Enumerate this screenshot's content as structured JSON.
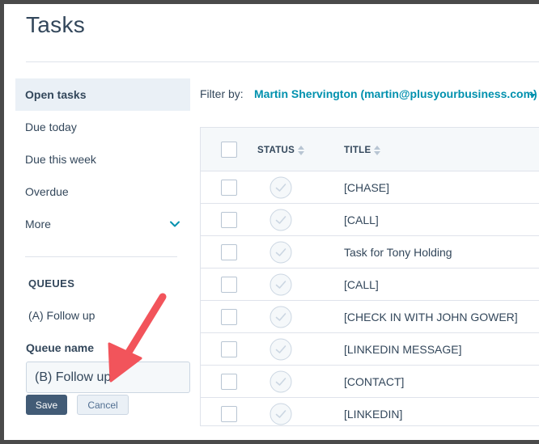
{
  "page": {
    "title": "Tasks"
  },
  "sidebar": {
    "items": [
      {
        "label": "Open tasks",
        "active": true
      },
      {
        "label": "Due today"
      },
      {
        "label": "Due this week"
      },
      {
        "label": "Overdue"
      },
      {
        "label": "More"
      }
    ],
    "queues_heading": "QUEUES",
    "queue_items": [
      "(A) Follow up"
    ],
    "queue_name_label": "Queue name",
    "queue_name_value": "(B) Follow up",
    "save_label": "Save",
    "cancel_label": "Cancel"
  },
  "filter": {
    "label": "Filter by:",
    "value": "Martin Shervington (martin@plusyourbusiness.com)"
  },
  "table": {
    "columns": [
      "STATUS",
      "TITLE"
    ],
    "rows": [
      "[CHASE]",
      "[CALL]",
      "Task for Tony Holding",
      "[CALL]",
      "[CHECK IN WITH JOHN GOWER]",
      "[LINKEDIN MESSAGE]",
      "[CONTACT]",
      "[LINKEDIN]"
    ]
  },
  "colors": {
    "accent": "#0091ae",
    "primary_button": "#425b76",
    "annotation_arrow": "#f2545b"
  },
  "icons": {
    "more_chevron": "chevron-down-icon",
    "sort": "sort-icon",
    "status": "check-circle-icon",
    "annotation": "arrow-icon"
  }
}
